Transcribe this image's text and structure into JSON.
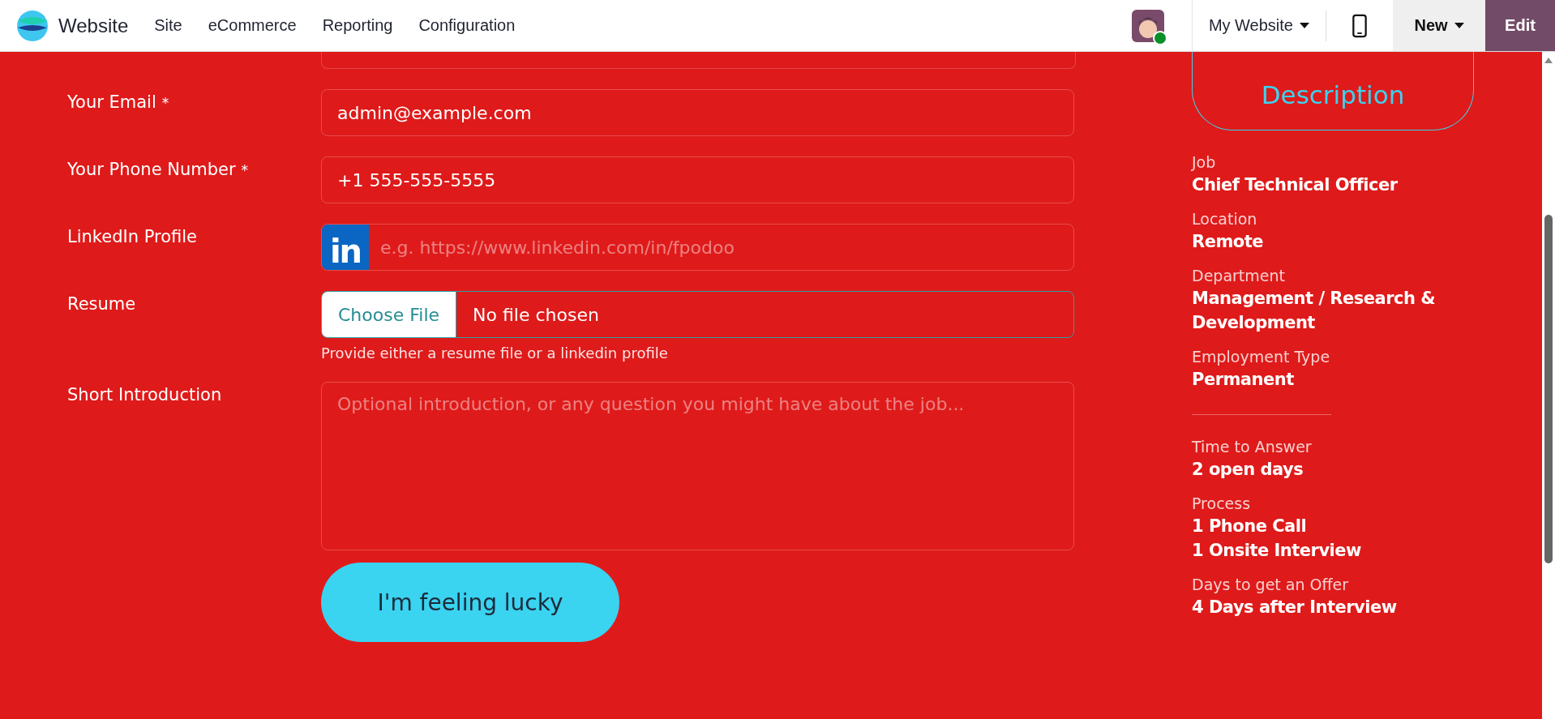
{
  "navbar": {
    "app_name": "Website",
    "menu": [
      "Site",
      "eCommerce",
      "Reporting",
      "Configuration"
    ],
    "user_online": true,
    "website_selector": "My Website",
    "new_button": "New",
    "edit_button": "Edit"
  },
  "form": {
    "fields": [
      {
        "kind": "text",
        "label": "Your Email",
        "required": true,
        "value": "admin@example.com"
      },
      {
        "kind": "text",
        "label": "Your Phone Number",
        "required": true,
        "value": "+1 555-555-5555"
      },
      {
        "kind": "linkedin",
        "label": "LinkedIn Profile",
        "required": false,
        "placeholder": "e.g. https://www.linkedin.com/in/fpodoo",
        "logo_text": "in"
      },
      {
        "kind": "file",
        "label": "Resume",
        "required": false,
        "button": "Choose File",
        "status": "No file chosen",
        "hint": "Provide either a resume file or a linkedin profile"
      },
      {
        "kind": "textarea",
        "label": "Short Introduction",
        "required": false,
        "placeholder": "Optional introduction, or any question you might have about the job..."
      }
    ],
    "required_mark": "*",
    "submit_button": "I'm feeling lucky"
  },
  "sidebar": {
    "back_button": "Description",
    "details": [
      {
        "label": "Job",
        "values": [
          "Chief Technical Officer"
        ]
      },
      {
        "label": "Location",
        "values": [
          "Remote"
        ]
      },
      {
        "label": "Department",
        "values": [
          "Management / Research & Development"
        ]
      },
      {
        "label": "Employment Type",
        "values": [
          "Permanent"
        ]
      }
    ],
    "process": [
      {
        "label": "Time to Answer",
        "values": [
          "2 open days"
        ]
      },
      {
        "label": "Process",
        "values": [
          "1 Phone Call",
          "1 Onsite Interview"
        ]
      },
      {
        "label": "Days to get an Offer",
        "values": [
          "4 Days after Interview"
        ]
      }
    ]
  }
}
